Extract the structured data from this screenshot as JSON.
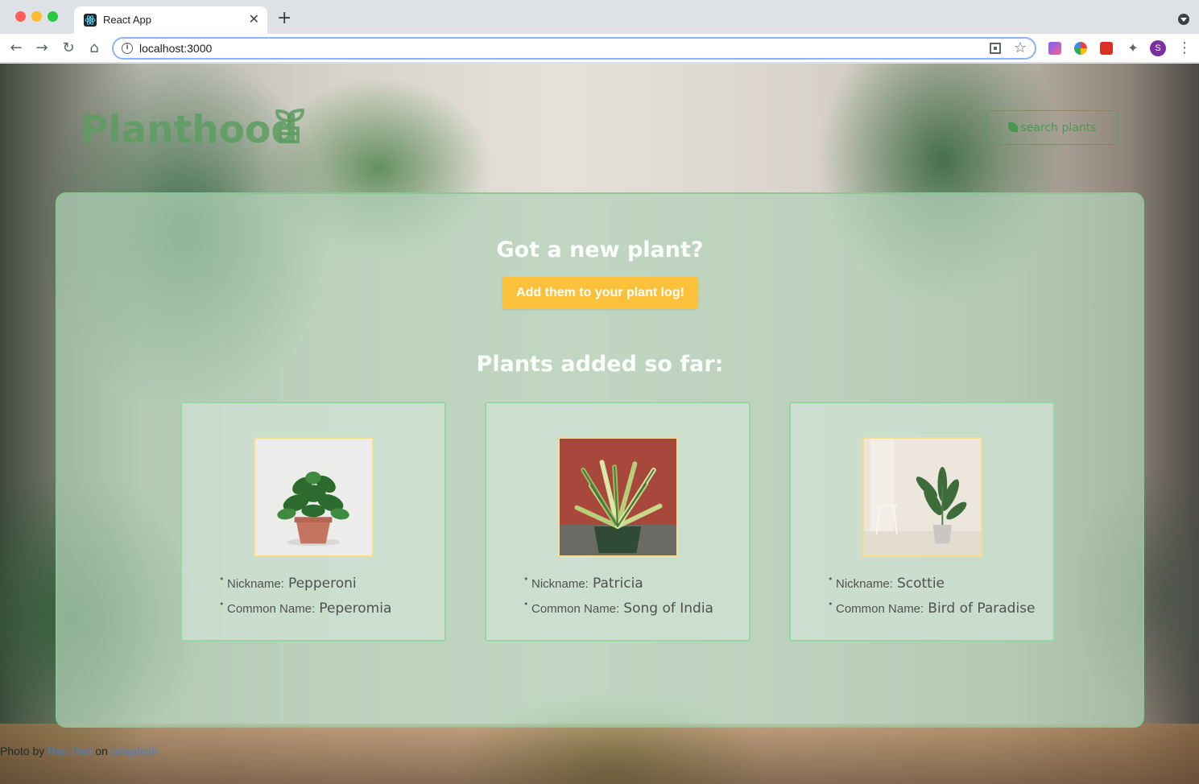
{
  "browser": {
    "tab_title": "React App",
    "url": "localhost:3000",
    "profile_initial": "S",
    "icons": {
      "tab_close": "close-icon",
      "new_tab": "plus-icon",
      "back": "arrow-left-icon",
      "forward": "arrow-right-icon",
      "reload": "reload-icon",
      "home": "home-icon",
      "site_info": "info-icon",
      "qr": "qr-code-icon",
      "bookmark": "star-icon",
      "extensions": "puzzle-icon",
      "menu": "kebab-menu-icon"
    }
  },
  "header": {
    "logo": "Planthood",
    "search_label": "search plants"
  },
  "main": {
    "new_plant_heading": "Got a new plant?",
    "add_button_label": "Add them to your plant log!",
    "plants_heading": "Plants added so far:",
    "nickname_label": "Nickname:",
    "common_name_label": "Common Name:",
    "plants": [
      {
        "nickname": "Pepperoni",
        "common_name": "Peperomia"
      },
      {
        "nickname": "Patricia",
        "common_name": "Song of India"
      },
      {
        "nickname": "Scottie",
        "common_name": "Bird of Paradise"
      }
    ]
  },
  "footer": {
    "credit_prefix": "Photo by",
    "photographer": "Ren Ran",
    "credit_middle": "on",
    "source": "Unsplash"
  },
  "colors": {
    "panel_border": "#86c890",
    "add_button": "#fbc13a",
    "heading_text": "#fbfdfb",
    "logo": "#5c9c62",
    "photo_border": "#f6dd8c",
    "link": "#4a7fc0"
  }
}
